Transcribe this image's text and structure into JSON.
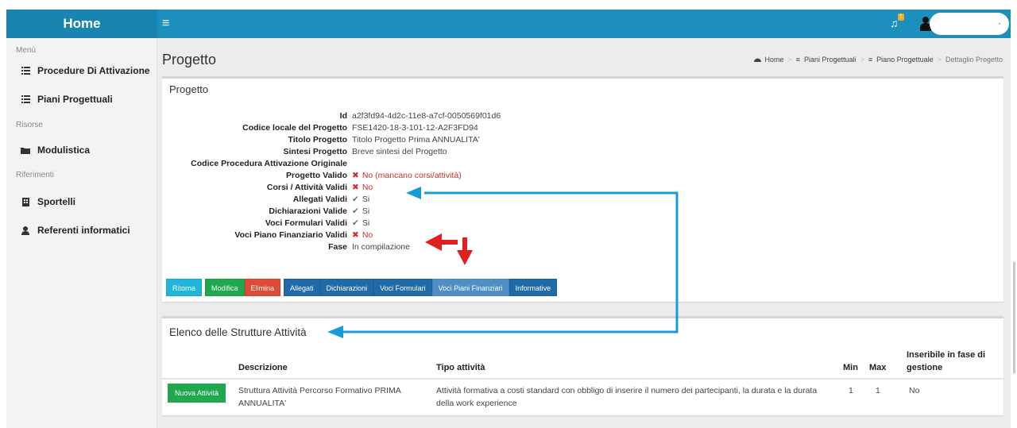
{
  "header": {
    "brand": "Home",
    "menu_icon": "hamburger-icon",
    "notification_count": "1",
    "notification_icon": "bell-icon",
    "user_icon": "user-icon",
    "dot": "·"
  },
  "sidebar": {
    "groups": [
      {
        "header": "Menù"
      },
      {
        "header": "Risorse"
      },
      {
        "header": "Riferimenti"
      }
    ],
    "items": [
      {
        "label": "Procedure Di Attivazione",
        "icon": "list-icon"
      },
      {
        "label": "Piani Progettuali",
        "icon": "list-icon"
      },
      {
        "label": "Modulistica",
        "icon": "folder-icon"
      },
      {
        "label": "Sportelli",
        "icon": "building-icon"
      },
      {
        "label": "Referenti informatici",
        "icon": "user-icon"
      }
    ]
  },
  "page": {
    "title": "Progetto",
    "breadcrumb": [
      "Home",
      "Piani Progettuali",
      "Piano Progettuale",
      "Dettaglio Progetto"
    ]
  },
  "progetto": {
    "title": "Progetto",
    "fields": [
      {
        "label": "Id",
        "value": "a2f3fd94-4d2c-11e8-a7cf-0050569f01d6"
      },
      {
        "label": "Codice locale del Progetto",
        "value": "FSE1420-18-3-101-12-A2F3FD94"
      },
      {
        "label": "Titolo Progetto",
        "value": "Titolo Progetto Prima ANNUALITA'"
      },
      {
        "label": "Sintesi Progetto",
        "value": "Breve sintesi del Progetto"
      },
      {
        "label": "Codice Procedura Attivazione Originale",
        "value": ""
      },
      {
        "label": "Progetto Valido",
        "value": "No (mancano corsi/attività)",
        "status": "x"
      },
      {
        "label": "Corsi / Attività Validi",
        "value": "No",
        "status": "x"
      },
      {
        "label": "Allegati Validi",
        "value": "Si",
        "status": "ok"
      },
      {
        "label": "Dichiarazioni Valide",
        "value": "Si",
        "status": "ok"
      },
      {
        "label": "Voci Formulari Validi",
        "value": "Si",
        "status": "ok"
      },
      {
        "label": "Voci Piano Finanziario Validi",
        "value": "No",
        "status": "x"
      },
      {
        "label": "Fase",
        "value": "In compilazione"
      }
    ],
    "buttons": {
      "ritorna": "Ritorna",
      "modifica": "Modifica",
      "elimina": "Elimina",
      "allegati": "Allegati",
      "dichiarazioni": "Dichiarazioni",
      "voci_formulari": "Voci Formulari",
      "voci_piani_finanziari": "Voci Piani Finanziari",
      "informative": "Informative"
    }
  },
  "strutture": {
    "title": "Elenco delle Strutture Attività",
    "columns": {
      "descrizione": "Descrizione",
      "tipo": "Tipo attività",
      "min": "Min",
      "max": "Max",
      "inseribile_1": "Inseribile in fase di",
      "inseribile_2": "gestione"
    },
    "new_button": "Nuova Attività",
    "rows": [
      {
        "descrizione_1": "Struttura Attività Percorso Formativo PRIMA",
        "descrizione_2": "ANNUALITA'",
        "tipo_1": "Attività formativa a costi standard con obbligo di inserire il numero dei partecipanti, la durata e la durata",
        "tipo_2": "della work experience",
        "min": "1",
        "max": "1",
        "inseribile": "No"
      }
    ]
  },
  "colors": {
    "topbar": "#1d8fbd",
    "arrow_blue": "#1a9ad9",
    "arrow_red": "#e02020"
  }
}
